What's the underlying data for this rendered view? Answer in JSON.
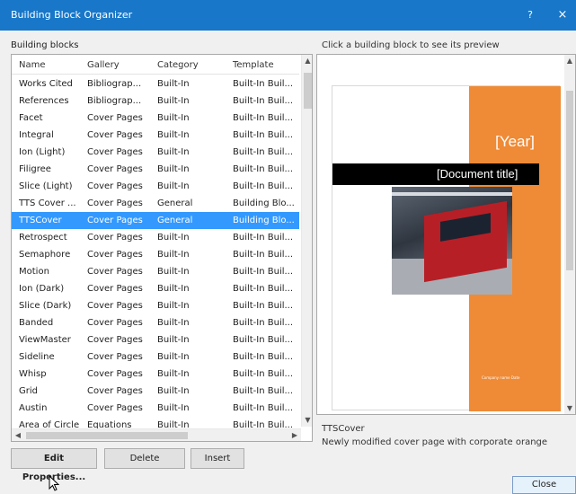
{
  "window": {
    "title": "Building Block Organizer",
    "help": "?",
    "close": "×"
  },
  "left_label": "Building blocks",
  "preview_label": "Click a building block to see its preview",
  "table": {
    "headers": [
      "Name",
      "Gallery",
      "Category",
      "Template"
    ],
    "rows": [
      [
        "Works Cited",
        "Bibliograp...",
        "Built-In",
        "Built-In Buil..."
      ],
      [
        "References",
        "Bibliograp...",
        "Built-In",
        "Built-In Buil..."
      ],
      [
        "Facet",
        "Cover Pages",
        "Built-In",
        "Built-In Buil..."
      ],
      [
        "Integral",
        "Cover Pages",
        "Built-In",
        "Built-In Buil..."
      ],
      [
        "Ion (Light)",
        "Cover Pages",
        "Built-In",
        "Built-In Buil..."
      ],
      [
        "Filigree",
        "Cover Pages",
        "Built-In",
        "Built-In Buil..."
      ],
      [
        "Slice (Light)",
        "Cover Pages",
        "Built-In",
        "Built-In Buil..."
      ],
      [
        "TTS Cover ...",
        "Cover Pages",
        "General",
        "Building Blo..."
      ],
      [
        "TTSCover",
        "Cover Pages",
        "General",
        "Building Blo..."
      ],
      [
        "Retrospect",
        "Cover Pages",
        "Built-In",
        "Built-In Buil..."
      ],
      [
        "Semaphore",
        "Cover Pages",
        "Built-In",
        "Built-In Buil..."
      ],
      [
        "Motion",
        "Cover Pages",
        "Built-In",
        "Built-In Buil..."
      ],
      [
        "Ion (Dark)",
        "Cover Pages",
        "Built-In",
        "Built-In Buil..."
      ],
      [
        "Slice (Dark)",
        "Cover Pages",
        "Built-In",
        "Built-In Buil..."
      ],
      [
        "Banded",
        "Cover Pages",
        "Built-In",
        "Built-In Buil..."
      ],
      [
        "ViewMaster",
        "Cover Pages",
        "Built-In",
        "Built-In Buil..."
      ],
      [
        "Sideline",
        "Cover Pages",
        "Built-In",
        "Built-In Buil..."
      ],
      [
        "Whisp",
        "Cover Pages",
        "Built-In",
        "Built-In Buil..."
      ],
      [
        "Grid",
        "Cover Pages",
        "Built-In",
        "Built-In Buil..."
      ],
      [
        "Austin",
        "Cover Pages",
        "Built-In",
        "Built-In Buil..."
      ],
      [
        "Area of Circle",
        "Equations",
        "Built-In",
        "Built-In Buil..."
      ]
    ],
    "selected_index": 8
  },
  "preview": {
    "year": "[Year]",
    "doc_title": "[Document title]",
    "company": "Company name Date"
  },
  "description": {
    "name": "TTSCover",
    "text": "Newly modified cover page with corporate orange"
  },
  "buttons": {
    "edit": "Edit Properties...",
    "delete": "Delete",
    "insert": "Insert",
    "close": "Close"
  },
  "colors": {
    "titlebar": "#1877c8",
    "selection": "#3399ff",
    "accent_orange": "#ef8a36"
  }
}
